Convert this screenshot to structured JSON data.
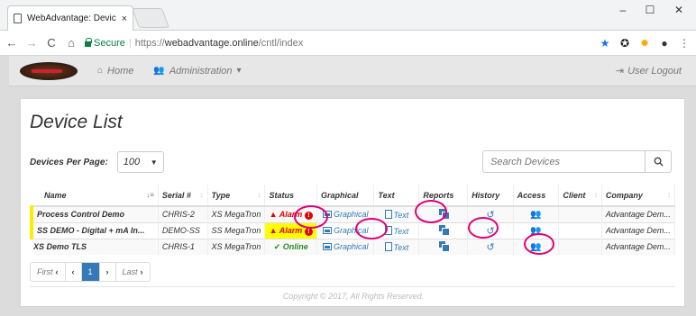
{
  "browser": {
    "tab_title": "WebAdvantage: Device L",
    "tab_close": "×",
    "window_buttons": {
      "minimize": "–",
      "maximize": "☐",
      "close": "✕"
    },
    "nav": {
      "back": "←",
      "forward": "→",
      "reload": "C",
      "home": "⌂"
    },
    "secure_label": "Secure",
    "url_scheme": "https://",
    "url_host": "webadvantage.online",
    "url_path": "/cntl/index",
    "extensions": [
      "star-icon",
      "extension-icon",
      "bookmark-icon",
      "chrome-icon",
      "menu-icon"
    ],
    "ext_glyphs": {
      "star": "★",
      "ext1": "✪",
      "ext2": "✹",
      "ext3": "●",
      "menu": "⋮"
    }
  },
  "navbar": {
    "home_label": "Home",
    "admin_label": "Administration",
    "logout_label": "User Logout"
  },
  "page": {
    "title": "Device List",
    "per_page_label": "Devices Per Page:",
    "per_page_value": "100",
    "search_placeholder": "Search Devices"
  },
  "table": {
    "headers": [
      "Name",
      "Serial #",
      "Type",
      "Status",
      "Graphical",
      "Text",
      "Reports",
      "History",
      "Access",
      "Client",
      "Company"
    ],
    "rows": [
      {
        "name": "Process Control Demo",
        "serial": "CHRIS-2",
        "type": "XS MegaTron",
        "status": "Alarm",
        "graphical": "Graphical",
        "text": "Text",
        "company": "Advantage Dem..."
      },
      {
        "name": "SS DEMO - Digital + mA In...",
        "serial": "DEMO-SS",
        "type": "SS MegaTron",
        "status": "Alarm",
        "graphical": "Graphical",
        "text": "Text",
        "company": "Advantage Dem..."
      },
      {
        "name": "XS Demo TLS",
        "serial": "CHRIS-1",
        "type": "XS MegaTron",
        "status": "Online",
        "graphical": "Graphical",
        "text": "Text",
        "company": "Advantage Dem..."
      }
    ]
  },
  "pager": {
    "first": "First",
    "page": "1",
    "last": "Last"
  },
  "footer": {
    "copyright": "Copyright © 2017, All Rights Reserved."
  },
  "colors": {
    "accent": "#337ab7",
    "alarm_bg": "#ffff00",
    "alarm_text": "#e00000",
    "online": "#2a8a2a",
    "highlight_ring": "#e0007a"
  }
}
